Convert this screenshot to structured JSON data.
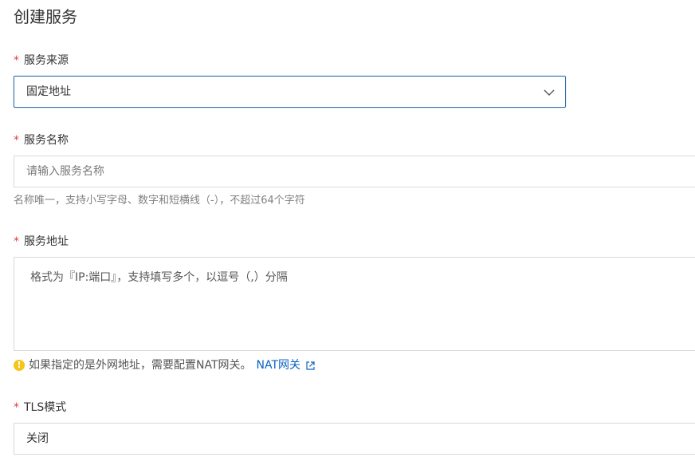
{
  "page": {
    "title": "创建服务"
  },
  "form": {
    "required_mark": "*",
    "service_source": {
      "label": "服务来源",
      "value": "固定地址"
    },
    "service_name": {
      "label": "服务名称",
      "placeholder": "请输入服务名称",
      "help": "名称唯一，支持小写字母、数字和短横线（-），不超过64个字符"
    },
    "service_address": {
      "label": "服务地址",
      "placeholder": "格式为『IP:端口』，支持填写多个，以逗号（,）分隔",
      "notice": "如果指定的是外网地址，需要配置NAT网关。",
      "link_label": "NAT网关"
    },
    "tls_mode": {
      "label": "TLS模式",
      "value": "关闭"
    }
  },
  "icons": {
    "dropdown": "chevron-down-icon",
    "warning": "warning-icon",
    "external_link": "external-link-icon"
  },
  "colors": {
    "required": "#e23c39",
    "link": "#0b64c0",
    "focus_border": "#2f6ea8",
    "warning": "#f5c518"
  }
}
